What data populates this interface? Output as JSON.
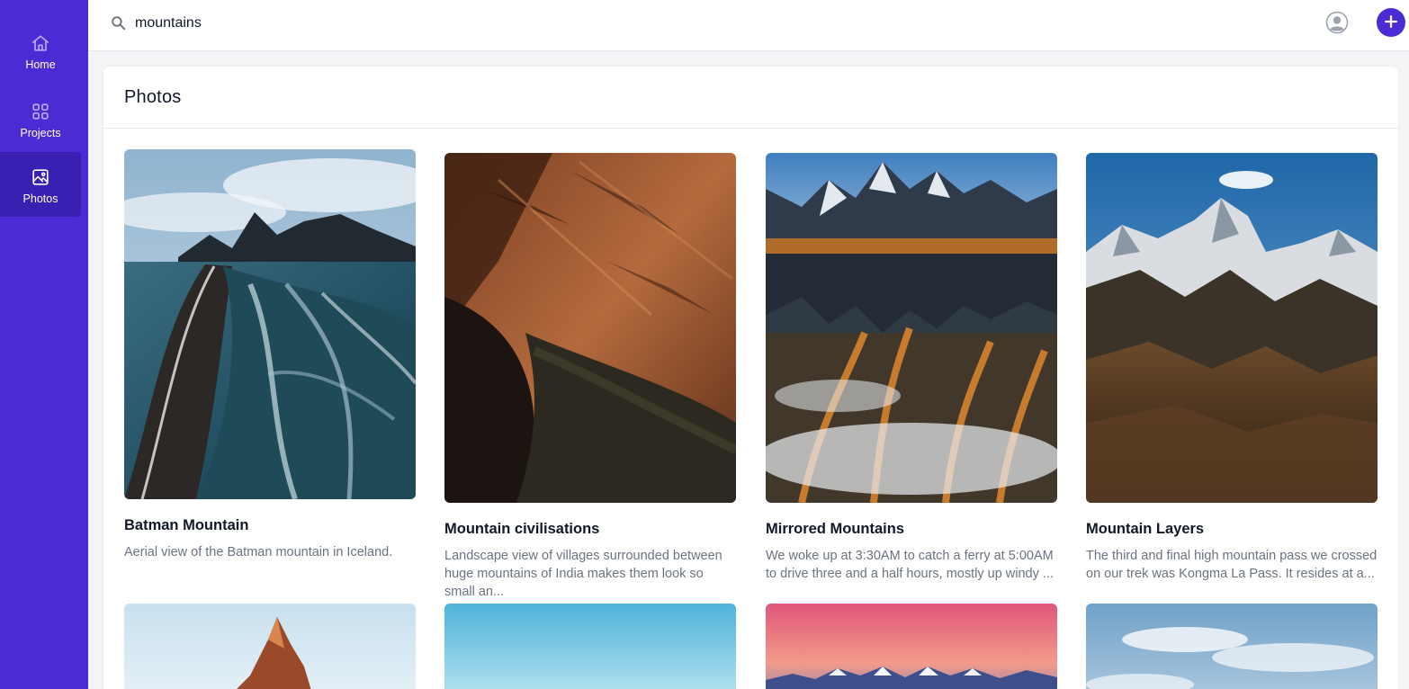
{
  "nav": {
    "home": "Home",
    "projects": "Projects",
    "photos": "Photos"
  },
  "search": {
    "value": "mountains"
  },
  "panel": {
    "title": "Photos"
  },
  "photos": [
    {
      "title": "Batman Mountain",
      "description": "Aerial view of the Batman mountain in Iceland."
    },
    {
      "title": "Mountain civilisations",
      "description": "Landscape view of villages surrounded between huge mountains of India makes them look so small an..."
    },
    {
      "title": "Mirrored Mountains",
      "description": "We woke up at 3:30AM to catch a ferry at 5:00AM to drive three and a half hours, mostly up windy ..."
    },
    {
      "title": "Mountain Layers",
      "description": "The third and final high mountain pass we crossed on our trek was Kongma La Pass. It resides at a..."
    }
  ],
  "colors": {
    "brand": "#4b2bd4",
    "brand_active": "#3a1fb3",
    "text_muted": "#6b7280"
  },
  "icons": {
    "home": "home-icon",
    "projects": "grid-icon",
    "photos": "image-icon",
    "search": "search-icon",
    "avatar": "user-circle-icon",
    "add": "plus-icon"
  }
}
